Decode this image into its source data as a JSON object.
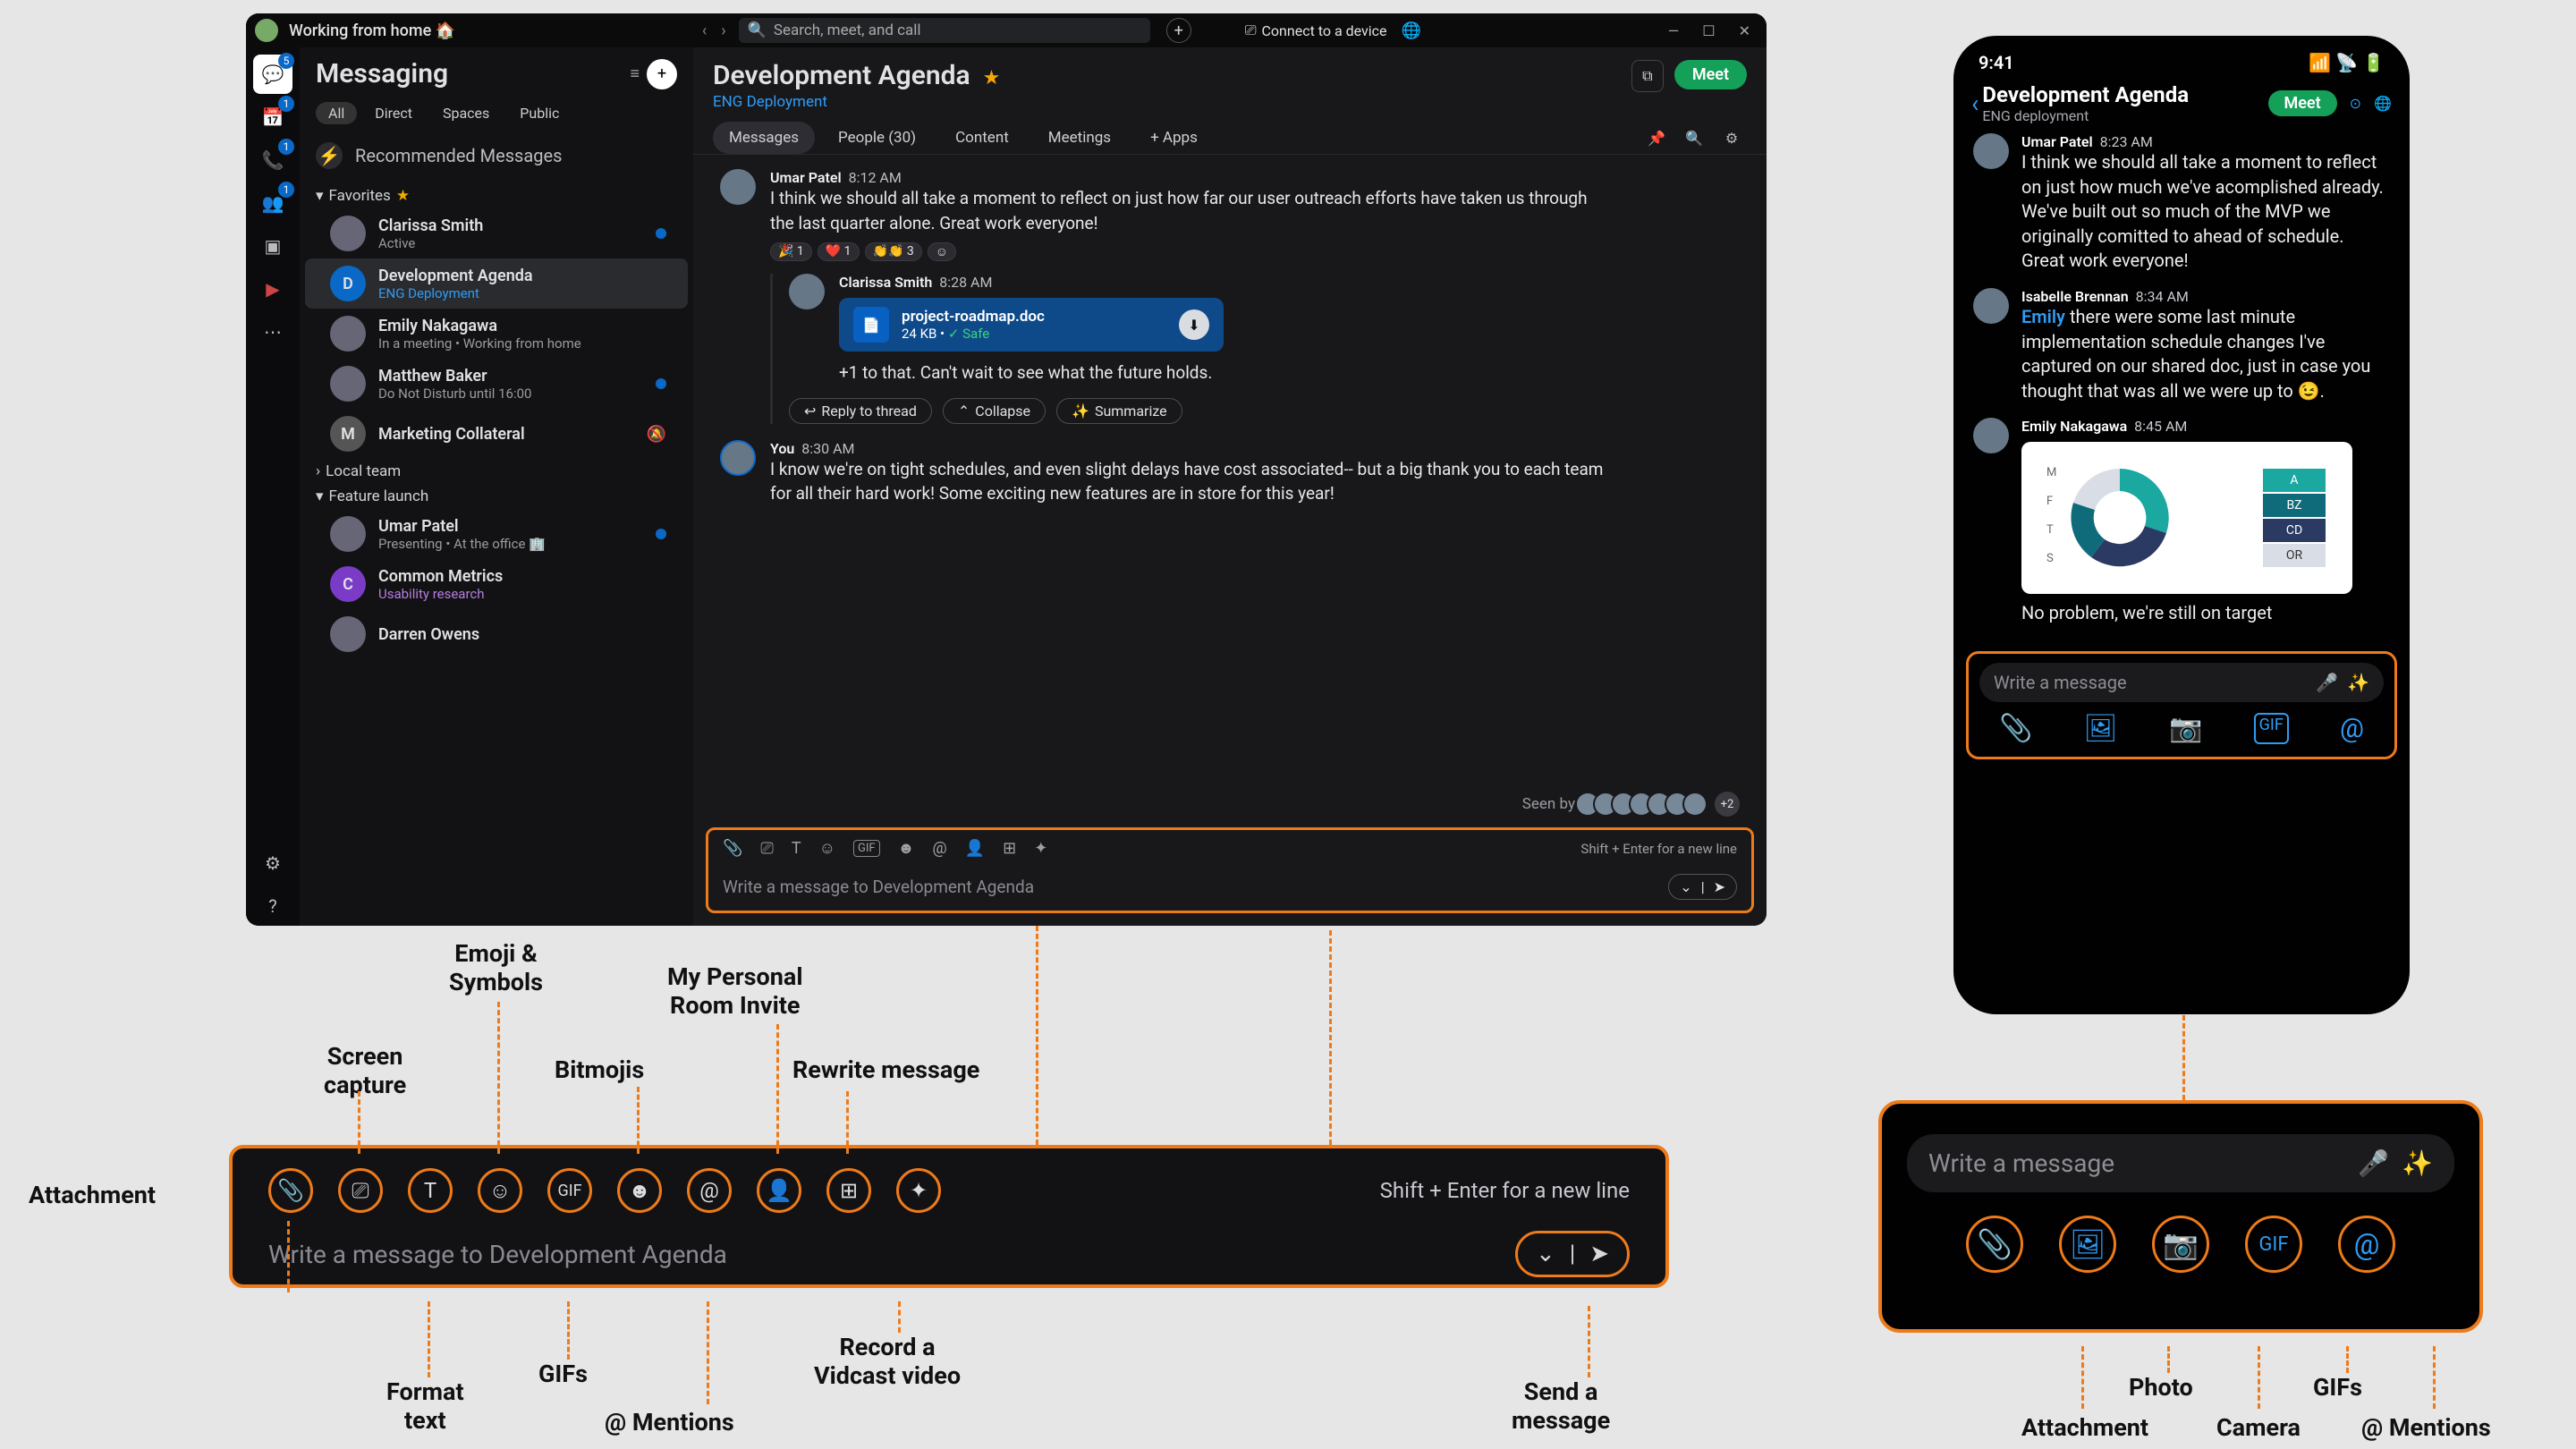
{
  "desktop": {
    "status": "Working from home 🏠",
    "search_placeholder": "Search, meet, and call",
    "connect": "Connect to a device",
    "rail": {
      "chat_badge": "5",
      "cal_badge": "1",
      "phone_badge": "1",
      "team_badge": "1"
    }
  },
  "sidebar": {
    "title": "Messaging",
    "filters": [
      "All",
      "Direct",
      "Spaces",
      "Public"
    ],
    "recommended": "Recommended Messages",
    "favorites_label": "Favorites",
    "local_team": "Local team",
    "feature_launch": "Feature launch",
    "items": {
      "clarissa": {
        "name": "Clarissa Smith",
        "sub": "Active"
      },
      "dev": {
        "name": "Development Agenda",
        "sub": "ENG Deployment"
      },
      "emily": {
        "name": "Emily Nakagawa",
        "sub": "In a meeting  •  Working from home"
      },
      "matt": {
        "name": "Matthew Baker",
        "sub": "Do Not Disturb until 16:00"
      },
      "mc": {
        "name": "Marketing Collateral"
      },
      "umar": {
        "name": "Umar Patel",
        "sub": "Presenting  •  At the office 🏢"
      },
      "cm": {
        "name": "Common Metrics",
        "sub": "Usability research"
      },
      "darren": {
        "name": "Darren Owens"
      }
    }
  },
  "room": {
    "title": "Development Agenda",
    "subtitle": "ENG Deployment",
    "meet": "Meet",
    "tabs": {
      "messages": "Messages",
      "people": "People (30)",
      "content": "Content",
      "meetings": "Meetings",
      "apps": "+  Apps"
    }
  },
  "messages": {
    "m1": {
      "who": "Umar Patel",
      "time": "8:12 AM",
      "body": "I think we should all take a moment to reflect on just how far our user outreach efforts have taken us through the last quarter alone. Great work everyone!",
      "react1": "🎉 1",
      "react2": "❤️ 1",
      "react3": "👏👏 3"
    },
    "m2": {
      "who": "Clarissa Smith",
      "time": "8:28 AM"
    },
    "file": {
      "name": "project-roadmap.doc",
      "size": "24 KB  •  ",
      "safe": "Safe"
    },
    "m2b": "+1 to that. Can't wait to see what the future holds.",
    "reply_btn": "Reply to thread",
    "collapse_btn": "Collapse",
    "summarize_btn": "Summarize",
    "m3": {
      "who": "You",
      "time": "8:30 AM",
      "body": "I know we're on tight schedules, and even slight delays have cost associated-- but a big thank you to each team for all their hard work! Some exciting new features are in store for this year!"
    },
    "seen": "Seen by",
    "seen_more": "+2"
  },
  "compose": {
    "placeholder": "Write a message to Development Agenda",
    "hint": "Shift + Enter for a new line"
  },
  "zoom_labels": {
    "attachment": "Attachment",
    "screen": "Screen\ncapture",
    "format": "Format\ntext",
    "emoji": "Emoji &\nSymbols",
    "gifs": "GIFs",
    "bitmoji": "Bitmojis",
    "mentions": "@ Mentions",
    "room_invite": "My Personal\nRoom Invite",
    "vidcast": "Record a\nVidcast video",
    "rewrite": "Rewrite message",
    "send": "Send a\nmessage"
  },
  "phone": {
    "time": "9:41",
    "title": "Development Agenda",
    "sub": "ENG deployment",
    "meet": "Meet",
    "m1": {
      "who": "Umar Patel",
      "time": "8:23 AM",
      "body": "I think we should all take a moment to reflect on just how much we've acomplished already. We've built out so much of the MVP we originally comitted to ahead of schedule. Great work everyone!"
    },
    "m2": {
      "who": "Isabelle Brennan",
      "time": "8:34 AM",
      "body_pre": "Emily",
      "body": " there were some last minute implementation schedule changes I've captured on our shared doc, just in case you thought that was all we were up to 😉."
    },
    "m3": {
      "who": "Emily Nakagawa",
      "time": "8:45 AM",
      "body": "No problem, we're still on target"
    },
    "compose_placeholder": "Write a message"
  },
  "mobile_zoom": {
    "placeholder": "Write a message",
    "labels": {
      "attachment": "Attachment",
      "photo": "Photo",
      "camera": "Camera",
      "gifs": "GIFs",
      "mentions": "@ Mentions"
    }
  },
  "chart_data": {
    "type": "pie",
    "title": "",
    "series": [
      {
        "name": "A",
        "value": 30,
        "color": "#0f6b7a"
      },
      {
        "name": "BZ",
        "value": 35,
        "color": "#1aa8a0"
      },
      {
        "name": "CD",
        "value": 20,
        "color": "#2b3a63"
      },
      {
        "name": "OR",
        "value": 15,
        "color": "#d9dde5"
      }
    ],
    "legend_side": [
      "M",
      "F",
      "T",
      "S"
    ]
  }
}
